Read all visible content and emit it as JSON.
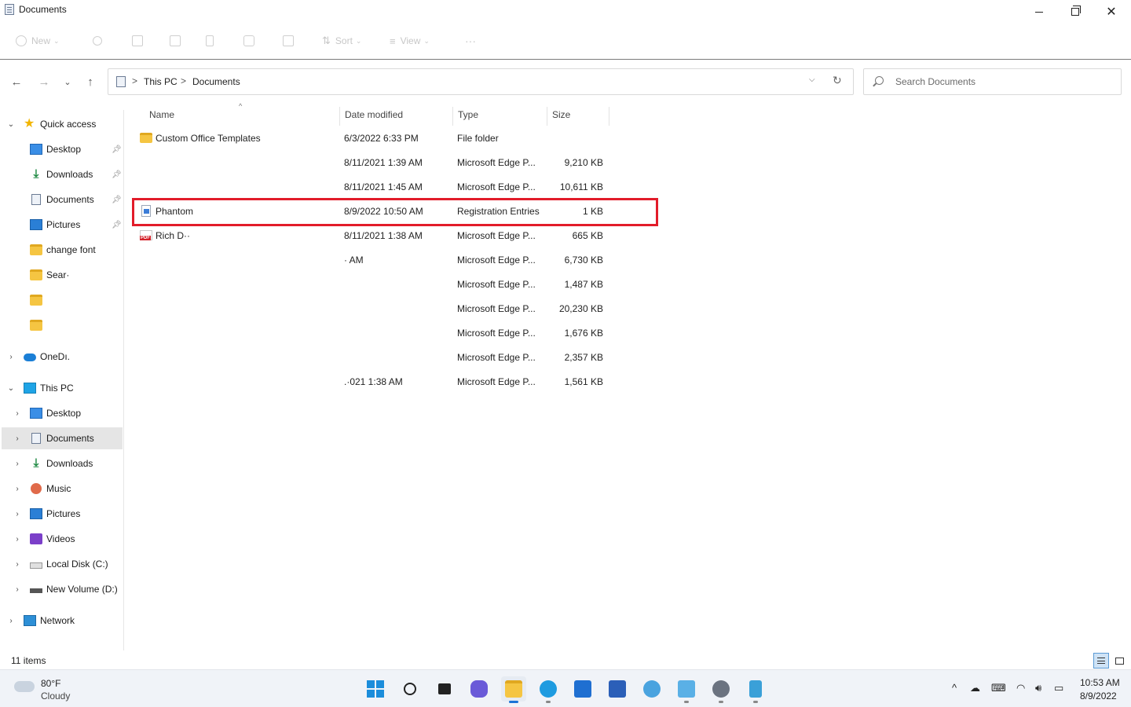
{
  "window": {
    "title": "Documents",
    "minimize_glyph": "—",
    "close_glyph": "✕"
  },
  "toolbar": {
    "new_label": "New",
    "sort_label": "Sort",
    "view_label": "View",
    "more_label": "···"
  },
  "nav": {
    "back": "←",
    "forward": "→",
    "recent": "⌄",
    "up": "↑"
  },
  "address": {
    "breadcrumb": [
      "This PC",
      "Documents"
    ],
    "separator": ">"
  },
  "search": {
    "placeholder": "Search Documents"
  },
  "sidebar": {
    "quick_access": "Quick access",
    "quick_items": [
      {
        "label": "Desktop",
        "icon": "desktop-icon",
        "pinned": true
      },
      {
        "label": "Downloads",
        "icon": "download-icon",
        "pinned": true
      },
      {
        "label": "Documents",
        "icon": "document-icon",
        "pinned": true
      },
      {
        "label": "Pictures",
        "icon": "pictures-icon",
        "pinned": true
      },
      {
        "label": "change font",
        "icon": "folder-icon",
        "pinned": false
      },
      {
        "label": "Sear·",
        "icon": "folder-icon",
        "pinned": false
      },
      {
        "label": "",
        "icon": "folder-icon",
        "pinned": false
      },
      {
        "label": "",
        "icon": "folder-icon",
        "pinned": false
      }
    ],
    "onedrive": "OneDı.",
    "this_pc": "This PC",
    "pc_items": [
      {
        "label": "Desktop",
        "icon": "desktop-icon"
      },
      {
        "label": "Documents",
        "icon": "document-icon",
        "selected": true
      },
      {
        "label": "Downloads",
        "icon": "download-icon"
      },
      {
        "label": "Music",
        "icon": "music-icon"
      },
      {
        "label": "Pictures",
        "icon": "pictures-icon"
      },
      {
        "label": "Videos",
        "icon": "videos-icon"
      },
      {
        "label": "Local Disk (C:)",
        "icon": "disk-icon"
      },
      {
        "label": "New Volume (D:)",
        "icon": "drive-icon"
      }
    ],
    "network": "Network"
  },
  "filelist": {
    "columns": [
      "Name",
      "Date modified",
      "Type",
      "Size"
    ],
    "sort_indicator": "^",
    "rows": [
      {
        "name": "Custom Office Templates",
        "date": "6/3/2022 6:33 PM",
        "type": "File folder",
        "size": "",
        "icon": "folder-icon"
      },
      {
        "name": "",
        "date": "8/11/2021 1:39 AM",
        "type": "Microsoft Edge P...",
        "size": "9,210 KB",
        "icon": ""
      },
      {
        "name": "",
        "date": "8/11/2021 1:45 AM",
        "type": "Microsoft Edge P...",
        "size": "10,611 KB",
        "icon": ""
      },
      {
        "name": "Phantom",
        "date": "8/9/2022 10:50 AM",
        "type": "Registration Entries",
        "size": "1 KB",
        "icon": "registry-file-icon"
      },
      {
        "name": "Rich D··",
        "date": "8/11/2021 1:38 AM",
        "type": "Microsoft Edge P...",
        "size": "665 KB",
        "icon": "pdf-icon"
      },
      {
        "name": "",
        "date": "· AM",
        "type": "Microsoft Edge P...",
        "size": "6,730 KB",
        "icon": ""
      },
      {
        "name": "",
        "date": "",
        "type": "Microsoft Edge P...",
        "size": "1,487 KB",
        "icon": ""
      },
      {
        "name": "",
        "date": "",
        "type": "Microsoft Edge P...",
        "size": "20,230 KB",
        "icon": ""
      },
      {
        "name": "",
        "date": "",
        "type": "Microsoft Edge P...",
        "size": "1,676 KB",
        "icon": ""
      },
      {
        "name": "",
        "date": "",
        "type": "Microsoft Edge P...",
        "size": "2,357 KB",
        "icon": ""
      },
      {
        "name": "",
        "date": ".·021 1:38 AM",
        "type": "Microsoft Edge P...",
        "size": "1,561 KB",
        "icon": ""
      }
    ]
  },
  "status": {
    "item_count": "11 items"
  },
  "taskbar": {
    "weather_temp": "80°F",
    "weather_cond": "Cloudy",
    "time": "10:53 AM",
    "date": "8/9/2022",
    "tray_overflow": "^"
  },
  "colors": {
    "highlight_box": "#e21c2a",
    "selection_bg": "#e5e5e5",
    "accent": "#1a73d6"
  }
}
